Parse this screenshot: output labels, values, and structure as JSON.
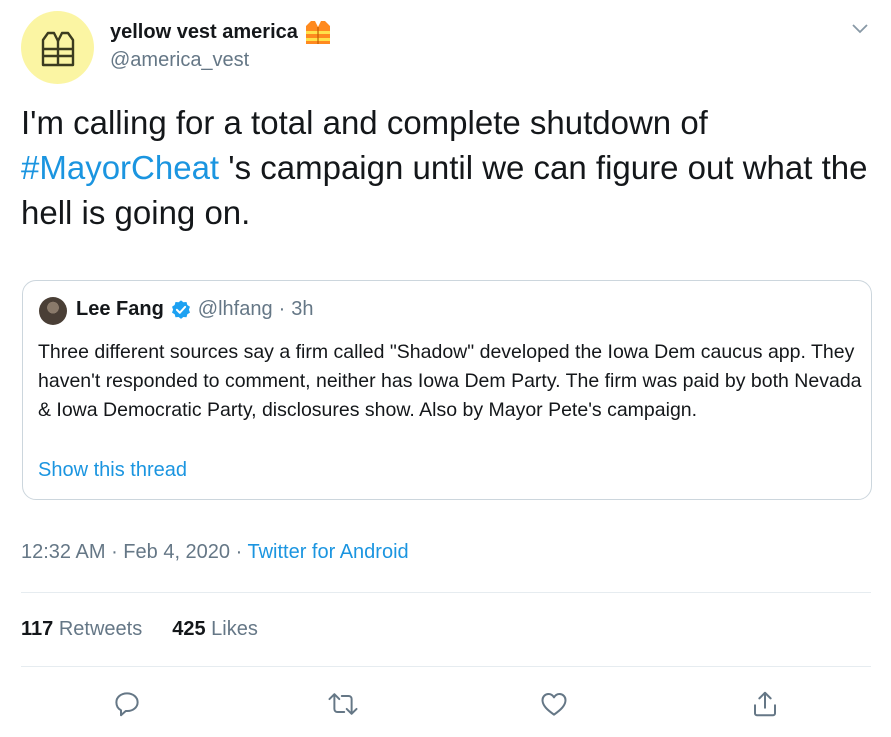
{
  "author": {
    "display_name": "yellow vest america",
    "handle": "@america_vest",
    "badge_icon": "construction-worker-vest-emoji",
    "avatar_bg": "#fbf5a3"
  },
  "tweet": {
    "text_before": "I'm calling for a total and complete shutdown of ",
    "hashtag": "#MayorCheat",
    "text_after": " 's campaign until we can figure out what the hell is going on."
  },
  "quoted_tweet": {
    "name": "Lee Fang",
    "handle": "@lhfang",
    "separator": "·",
    "time": "3h",
    "text": "Three different sources say a firm called \"Shadow\" developed the Iowa Dem caucus app. They haven't responded to comment, neither has Iowa Dem Party. The firm was paid by both Nevada & Iowa Democratic Party, disclosures show. Also by Mayor Pete's campaign.",
    "show_thread": "Show this thread"
  },
  "meta": {
    "time": "12:32 AM",
    "sep1": " · ",
    "date": "Feb 4, 2020",
    "sep2": " · ",
    "source": "Twitter for Android"
  },
  "stats": {
    "retweets_count": "117",
    "retweets_label": "Retweets",
    "likes_count": "425",
    "likes_label": "Likes"
  },
  "actions": [
    "reply-icon",
    "retweet-icon",
    "like-icon",
    "share-icon"
  ],
  "colors": {
    "link": "#1b95e0",
    "secondary_text": "#657786",
    "border": "#ccd6dd",
    "verified": "#1da1f2"
  }
}
